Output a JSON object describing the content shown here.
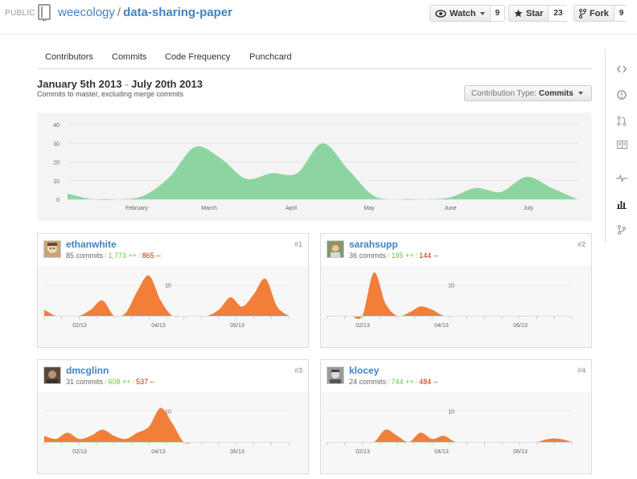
{
  "header": {
    "visibility": "PUBLIC",
    "owner": "weecology",
    "separator": "/",
    "repo": "data-sharing-paper",
    "watch": {
      "label": "Watch",
      "count": "9"
    },
    "star": {
      "label": "Star",
      "count": "23"
    },
    "fork": {
      "label": "Fork",
      "count": "9"
    }
  },
  "tabs": [
    "Contributors",
    "Commits",
    "Code Frequency",
    "Punchcard"
  ],
  "range": {
    "start": "January 5th 2013",
    "dash": "-",
    "end": "July 20th 2013",
    "subtitle": "Commits to master, excluding merge commits"
  },
  "contribution_type": {
    "label": "Contribution Type:",
    "value": "Commits"
  },
  "sidebar": [
    "code-icon",
    "issues-icon",
    "pull-request-icon",
    "wiki-icon",
    "pulse-icon",
    "graphs-icon",
    "network-icon"
  ],
  "contributors": [
    {
      "name": "ethanwhite",
      "commits": "85 commits",
      "additions": "1,773 ++",
      "deletions": "865 --",
      "rank": "#1"
    },
    {
      "name": "sarahsupp",
      "commits": "36 commits",
      "additions": "195 ++",
      "deletions": "144 --",
      "rank": "#2"
    },
    {
      "name": "dmcglinn",
      "commits": "31 commits",
      "additions": "608 ++",
      "deletions": "537 --",
      "rank": "#3"
    },
    {
      "name": "klocey",
      "commits": "24 commits",
      "additions": "744 ++",
      "deletions": "484 --",
      "rank": "#4"
    }
  ],
  "colors": {
    "main_area": "#8dd5a0",
    "contrib_area": "#f17f3a",
    "link": "#4183c4",
    "additions": "#6cc644",
    "deletions": "#bd2c00"
  },
  "chart_data": [
    {
      "type": "area",
      "title": "",
      "x": [
        "Jan 5",
        "Jan 26",
        "Feb 2",
        "Feb 9",
        "Feb 16",
        "Feb 23",
        "Mar 2",
        "Mar 9",
        "Mar 16",
        "Mar 23",
        "Mar 30",
        "Apr 6",
        "Apr 13",
        "Apr 20",
        "May 4",
        "May 25",
        "Jun 8",
        "Jun 22",
        "Jul 6",
        "Jul 13",
        "Jul 20"
      ],
      "values": [
        3,
        0,
        0,
        2,
        12,
        28,
        22,
        11,
        14,
        14,
        30,
        16,
        2,
        0,
        0,
        1,
        6,
        4,
        12,
        6,
        0
      ],
      "x_ticks": [
        "February",
        "March",
        "April",
        "May",
        "June",
        "July"
      ],
      "y_ticks": [
        "0",
        "10",
        "20",
        "30",
        "40"
      ],
      "ylim": [
        0,
        40
      ]
    },
    {
      "type": "area",
      "series_name": "ethanwhite",
      "x_ticks": [
        "02/13",
        "04/13",
        "06/13"
      ],
      "y_ticks": [
        "10"
      ],
      "values": [
        2,
        0,
        0,
        0,
        2,
        5,
        0,
        1,
        8,
        13,
        5,
        0,
        0,
        0,
        0,
        2,
        6,
        3,
        7,
        12,
        3,
        0
      ]
    },
    {
      "type": "area",
      "series_name": "sarahsupp",
      "x_ticks": [
        "02/13",
        "04/13",
        "06/13"
      ],
      "y_ticks": [
        "10"
      ],
      "values": [
        0,
        0,
        0,
        0,
        14,
        4,
        0,
        1,
        3,
        2,
        0,
        0,
        0,
        0,
        0,
        0,
        0,
        0,
        0,
        0,
        0,
        0
      ]
    },
    {
      "type": "area",
      "series_name": "dmcglinn",
      "x_ticks": [
        "02/13",
        "04/13",
        "06/13"
      ],
      "y_ticks": [
        "10"
      ],
      "values": [
        2,
        1,
        3,
        1,
        2,
        4,
        2,
        1,
        3,
        5,
        11,
        6,
        0,
        0,
        0,
        0,
        0,
        0,
        0,
        0,
        0,
        0
      ]
    },
    {
      "type": "area",
      "series_name": "klocey",
      "x_ticks": [
        "02/13",
        "04/13",
        "06/13"
      ],
      "y_ticks": [
        "10"
      ],
      "values": [
        0,
        0,
        0,
        0,
        0,
        4,
        2,
        0,
        3,
        1,
        2,
        0,
        0,
        0,
        0,
        0,
        0,
        0,
        0,
        1,
        1,
        0
      ]
    }
  ]
}
